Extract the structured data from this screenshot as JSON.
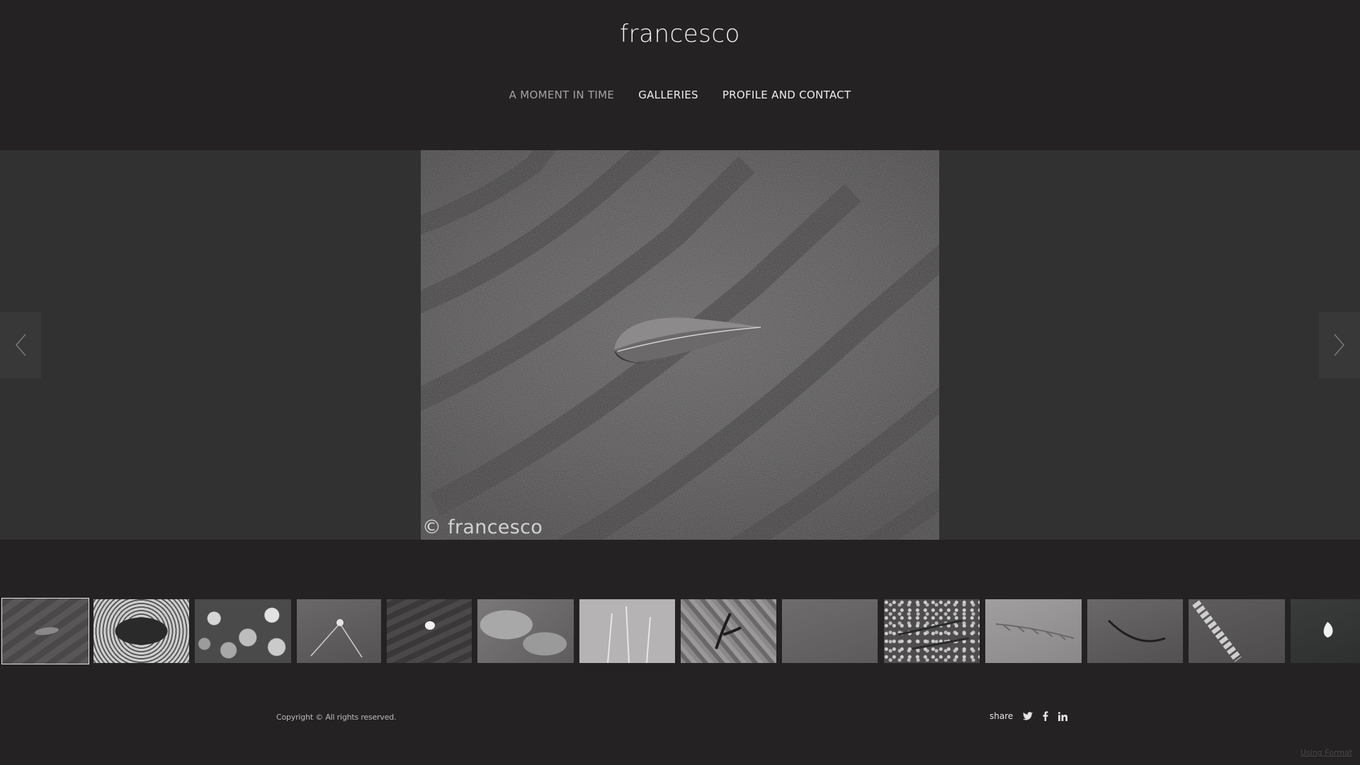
{
  "site": {
    "title": "francesco"
  },
  "nav": {
    "items": [
      {
        "label": "A MOMENT IN TIME",
        "active": true
      },
      {
        "label": "GALLERIES",
        "active": false
      },
      {
        "label": "PROFILE AND CONTACT",
        "active": false
      }
    ]
  },
  "hero": {
    "watermark": "© francesco",
    "prev_icon": "chevron-left-icon",
    "next_icon": "chevron-right-icon"
  },
  "thumbnails": [
    {
      "subject": "leaf-on-sand",
      "active": true
    },
    {
      "subject": "tangled-rope"
    },
    {
      "subject": "pebbles-and-leaves"
    },
    {
      "subject": "shell-tracks"
    },
    {
      "subject": "shell-on-ripples"
    },
    {
      "subject": "rocks-in-water"
    },
    {
      "subject": "grass-stalks"
    },
    {
      "subject": "seaweed-on-rock"
    },
    {
      "subject": "smooth-sand"
    },
    {
      "subject": "twigs-on-gravel"
    },
    {
      "subject": "feather-print"
    },
    {
      "subject": "seaweed-strand"
    },
    {
      "subject": "foam-line"
    },
    {
      "subject": "shell-on-dark-sand"
    }
  ],
  "footer": {
    "copyright": "Copyright © All rights reserved.",
    "share_label": "share",
    "share_icons": [
      "twitter-icon",
      "facebook-icon",
      "linkedin-icon"
    ],
    "using_format": "Using Format"
  },
  "colors": {
    "background": "#252223",
    "hero_band": "#313131",
    "nav_active": "#a6a2a2"
  }
}
